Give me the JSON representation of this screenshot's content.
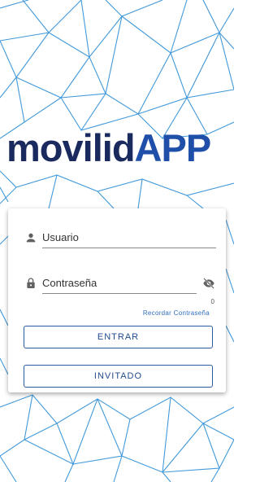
{
  "brand": {
    "part1": "movilid",
    "part2": "APP",
    "color_dark": "#1a2a5e",
    "color_blue": "#1f4fa8"
  },
  "login": {
    "username_placeholder": "Usuario",
    "password_placeholder": "Contraseña",
    "char_counter": "0",
    "forgot_password": "Recordar Contraseña",
    "enter_label": "ENTRAR",
    "guest_label": "INVITADO"
  },
  "icons": {
    "user": "person-icon",
    "lock": "lock-icon",
    "visibility": "visibility-off-icon"
  },
  "colors": {
    "accent": "#2a5aa0",
    "network_lines": "#2a8ad0"
  }
}
